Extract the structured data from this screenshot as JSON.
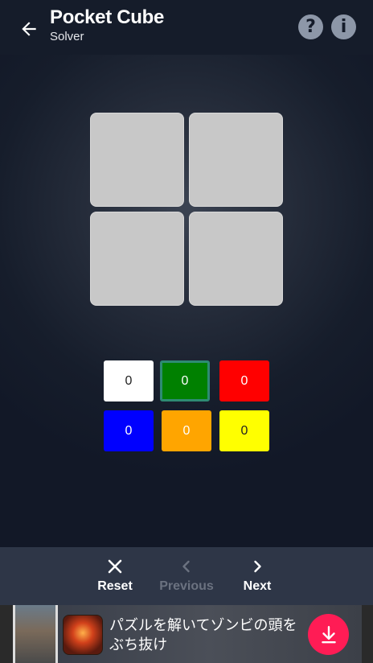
{
  "header": {
    "title": "Pocket Cube",
    "subtitle": "Solver",
    "help_label": "?",
    "info_label": "i"
  },
  "cube_face": {
    "stickers": [
      "",
      "",
      "",
      ""
    ],
    "sticker_color": "#c8c8c8"
  },
  "palette": [
    {
      "color": "white",
      "hex": "#ffffff",
      "count": "0"
    },
    {
      "color": "green",
      "hex": "#008000",
      "count": "0",
      "selected": true
    },
    {
      "color": "red",
      "hex": "#ff0000",
      "count": "0"
    },
    {
      "color": "blue",
      "hex": "#0000ff",
      "count": "0"
    },
    {
      "color": "orange",
      "hex": "#ffa500",
      "count": "0"
    },
    {
      "color": "yellow",
      "hex": "#ffff00",
      "count": "0"
    }
  ],
  "toolbar": {
    "reset_label": "Reset",
    "previous_label": "Previous",
    "next_label": "Next",
    "previous_disabled": true
  },
  "ad": {
    "text": "パズルを解いてゾンビの頭をぶち抜け",
    "download_color": "#ff1c55"
  }
}
